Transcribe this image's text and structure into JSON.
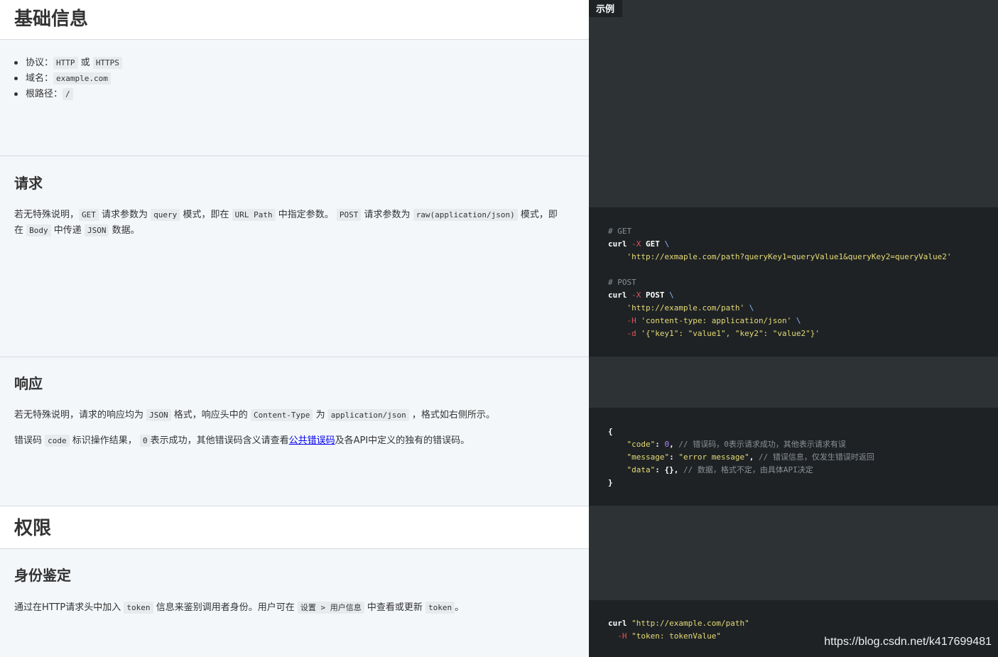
{
  "sections": {
    "basic": {
      "title": "基础信息",
      "items": [
        {
          "label": "协议：",
          "code1": "HTTP",
          "sep": "或",
          "code2": "HTTPS"
        },
        {
          "label": "域名：",
          "code1": "example.com"
        },
        {
          "label": "根路径：",
          "code1": "/"
        }
      ]
    },
    "request": {
      "title": "请求",
      "p1_a": "若无特殊说明，",
      "p1_c1": "GET",
      "p1_b": "请求参数为",
      "p1_c2": "query",
      "p1_d": "模式，即在",
      "p1_c3": "URL Path",
      "p1_e": "中指定参数。",
      "p1_c4": "POST",
      "p1_f": "请求参数为",
      "p1_c5": "raw(application/json)",
      "p1_g": "模式，即",
      "p2_a": "在",
      "p2_c1": "Body",
      "p2_b": "中传递",
      "p2_c2": "JSON",
      "p2_c": "数据。"
    },
    "response": {
      "title": "响应",
      "p1_a": "若无特殊说明，请求的响应均为",
      "p1_c1": "JSON",
      "p1_b": "格式，响应头中的",
      "p1_c2": "Content-Type",
      "p1_c": "为",
      "p1_c3": "application/json",
      "p1_d": "，格式如右侧所示。",
      "p2_a": "错误码",
      "p2_c1": "code",
      "p2_b": "标识操作结果，",
      "p2_c2": "0",
      "p2_c": "表示成功，其他错误码含义请查看",
      "p2_link": "公共错误码",
      "p2_d": "及各API中定义的独有的错误码。"
    },
    "permission": {
      "title": "权限"
    },
    "auth": {
      "title": "身份鉴定",
      "p_a": "通过在HTTP请求头中加入",
      "p_c1": "token",
      "p_b": "信息来鉴别调用者身份。用户可在",
      "p_c2": "设置 > 用户信息",
      "p_c": "中查看或更新",
      "p_c3": "token",
      "p_d": "。"
    }
  },
  "examples": {
    "tab": "示例",
    "get_comment": "# GET",
    "get_curl": "curl",
    "get_flag": "-X",
    "get_method": "GET",
    "get_url": "'http://exmaple.com/path?queryKey1=queryValue1&queryKey2=queryValue2'",
    "post_comment": "# POST",
    "post_curl": "curl",
    "post_flag": "-X",
    "post_method": "POST",
    "post_url": "'http://example.com/path'",
    "post_hflag": "-H",
    "post_header": "'content-type: application/json'",
    "post_dflag": "-d",
    "post_data": "'{\"key1\": \"value1\", \"key2\": \"value2\"}'",
    "resp_open": "{",
    "resp_code_key": "\"code\"",
    "resp_code_val": "0",
    "resp_code_comment": "// 错误码，0表示请求成功，其他表示请求有误",
    "resp_msg_key": "\"message\"",
    "resp_msg_val": "\"error message\"",
    "resp_msg_comment": "// 错误信息，仅发生错误时返回",
    "resp_data_key": "\"data\"",
    "resp_data_val": "{}",
    "resp_data_comment": "// 数据，格式不定，由具体API决定",
    "resp_close": "}",
    "auth_curl": "curl",
    "auth_url": "\"http://example.com/path\"",
    "auth_hflag": "-H",
    "auth_header": "\"token: tokenValue\""
  },
  "watermark": "https://blog.csdn.net/k417699481",
  "colors": {
    "left_bg": "#f4f7fa",
    "right_bg": "#2d3235",
    "code_bg": "#1e2225",
    "string": "#e6db74",
    "flag": "#e0545b"
  }
}
